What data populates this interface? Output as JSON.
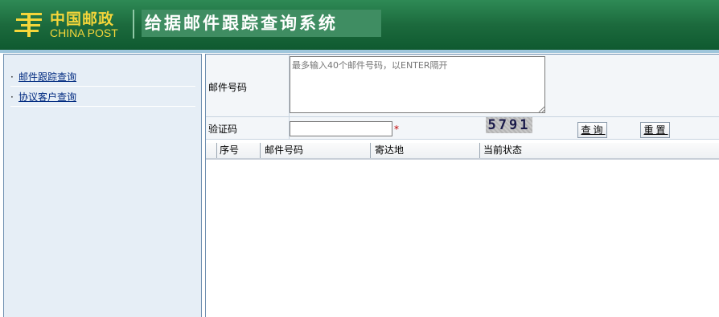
{
  "header": {
    "logo_cn": "中国邮政",
    "logo_en": "CHINA POST",
    "system_title": "给据邮件跟踪查询系统",
    "brand_color": "#1c6a3d",
    "logo_color": "#f5d63a"
  },
  "sidebar": {
    "items": [
      {
        "bullet": "·",
        "label": "邮件跟踪查询"
      },
      {
        "bullet": "·",
        "label": "协议客户查询"
      }
    ]
  },
  "form": {
    "mail_number_label": "邮件号码",
    "mail_number_placeholder": "最多输入40个邮件号码，以ENTER隔开",
    "captcha_label": "验证码",
    "captcha_value": "",
    "required_mark": "*",
    "captcha_text": "5791",
    "query_button": "查询",
    "reset_button": "重置"
  },
  "table": {
    "columns": [
      "序号",
      "邮件号码",
      "寄达地",
      "当前状态"
    ]
  }
}
